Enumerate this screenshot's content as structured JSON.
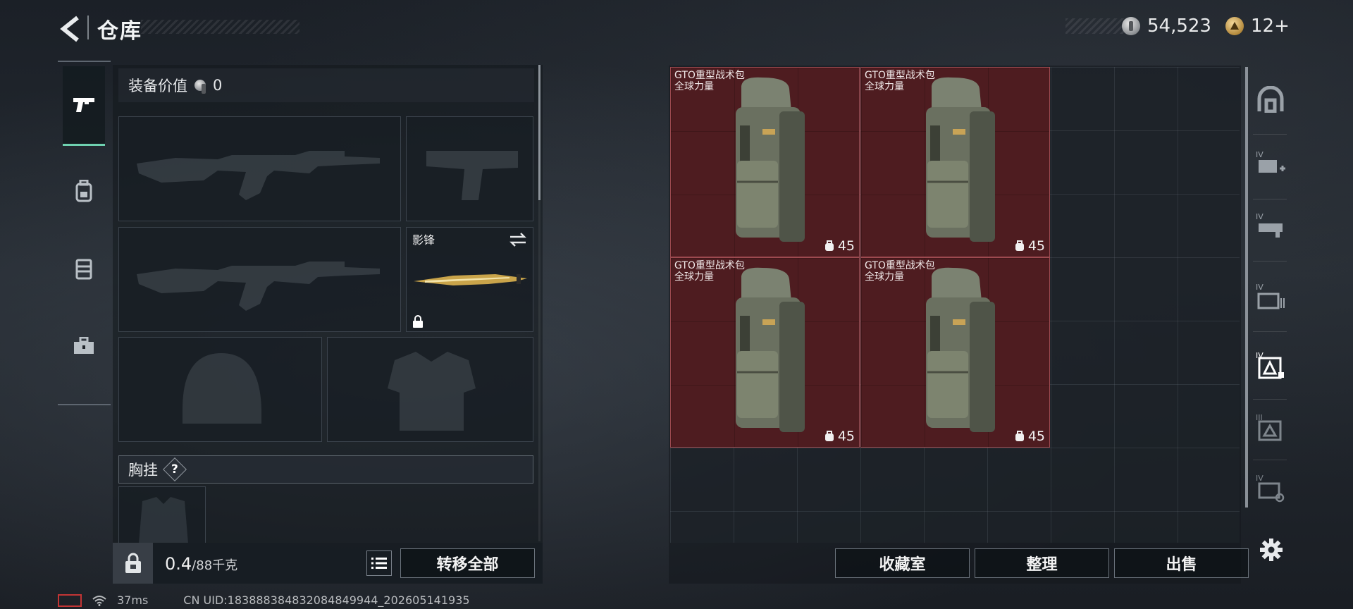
{
  "header": {
    "title": "仓库",
    "silver_amount": "54,523",
    "gold_amount": "12+"
  },
  "left_tabs": [
    "weapons-tab",
    "backpack-tab",
    "rig-tab",
    "toolbox-tab"
  ],
  "equipment": {
    "value_label": "装备价值",
    "value_amount": "0",
    "melee_slot_name": "影锋",
    "chest_label": "胸挂",
    "help_symbol": "?"
  },
  "weight": {
    "current": "0.4",
    "capacity": "/88千克"
  },
  "buttons": {
    "transfer_all": "转移全部",
    "collection_room": "收藏室",
    "organize": "整理",
    "sell": "出售"
  },
  "inventory": {
    "items": [
      {
        "name": "GTO重型战术包",
        "tag": "全球力量",
        "count": "45"
      },
      {
        "name": "GTO重型战术包",
        "tag": "全球力量",
        "count": "45"
      },
      {
        "name": "GTO重型战术包",
        "tag": "全球力量",
        "count": "45"
      },
      {
        "name": "GTO重型战术包",
        "tag": "全球力量",
        "count": "45"
      }
    ]
  },
  "right_icons": [
    "safehouse-icon",
    "container-plus-icon",
    "container-rifle-icon",
    "container-folder-icon",
    "container-crate-active-icon",
    "container-crate-icon",
    "container-gear-icon"
  ],
  "status_bar": {
    "ping": "37ms",
    "uid": "CN UID:18388838483208484994​4_202605141935"
  },
  "colors": {
    "accent": "#6fd1b0",
    "item_bg": "#4e1c20"
  }
}
